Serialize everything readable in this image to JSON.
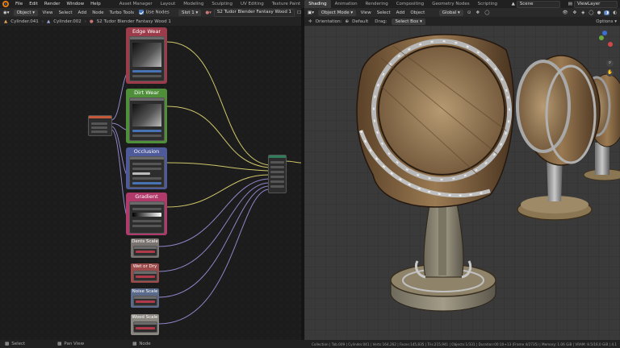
{
  "menubar": {
    "menus": [
      "File",
      "Edit",
      "Render",
      "Window",
      "Help"
    ],
    "workspaces": [
      "Asset Manager",
      "Layout",
      "Modeling",
      "Sculpting",
      "UV Editing",
      "Texture Paint",
      "Shading",
      "Animation",
      "Rendering",
      "Compositing",
      "Geometry Nodes",
      "Scripting"
    ],
    "active_workspace": "Shading",
    "scene": "Scene",
    "view_layer": "ViewLayer"
  },
  "node_header": {
    "object_mode": "Object",
    "menus": [
      "View",
      "Select",
      "Add",
      "Node"
    ],
    "turbo_tools": "Turbo Tools",
    "use_nodes": "Use Nodes",
    "slot": "Slot 1",
    "material": "S2 Tudor Blender Fantasy Wood 1"
  },
  "breadcrumb": [
    "Cylinder.041",
    "Cylinder.002",
    "S2 Tudor Blender Fantasy Wood 1"
  ],
  "view_header": {
    "mode": "Object Mode",
    "menus": [
      "View",
      "Select",
      "Add",
      "Object"
    ],
    "transform": "Global"
  },
  "view_tool_bar": {
    "orientation_label": "Orientation:",
    "orientation_value": "Default",
    "drag_label": "Drag:",
    "drag_value": "Select Box",
    "options": "Options"
  },
  "frames": {
    "edge_wear": "Edge Wear",
    "dirt_wear": "Dirt Wear",
    "occlusion": "Occlusion",
    "gradient_control": "Gradient Control",
    "small": [
      "Dents Scale",
      "Wet or Dry",
      "Noise Scale",
      "Wood Scale"
    ]
  },
  "colors": {
    "edge_wear": "#9c3b49",
    "dirt_wear": "#4f8f3a",
    "occlusion": "#4e5a9a",
    "gradient_control": "#b03a6a",
    "accent": "#4772b3",
    "wire_yellow": "#cfc66a",
    "wire_purple": "#8f86c9"
  },
  "statusbar": {
    "select": "Select",
    "pan_view": "Pan View",
    "node": "Node",
    "info": "Collection | Tab.009 | Cylinder.041 | Verts:164,262 | Faces:145,835 | Tris:215,941 | Objects:1/331 | Duration:00:10+13 (Frame 4/2735) | Memory: 1.06 GiB | VRAM: 8.5/16.0 GiB | 4.1"
  }
}
